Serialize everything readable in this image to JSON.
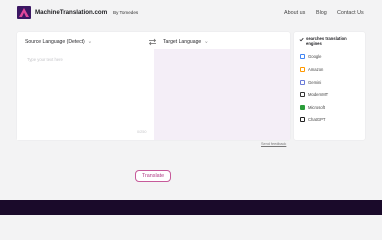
{
  "header": {
    "brand_name": "MachineTranslation.com",
    "brand_sub": "By Tomedes",
    "nav": [
      "About us",
      "Blog",
      "Contact Us"
    ]
  },
  "translator": {
    "source_language": "Source Language (Detect)",
    "target_language": "Target Language",
    "source_placeholder": "Type your text here",
    "char_count": "0/250",
    "feedback_link": "Send feedback",
    "translate_label": "Translate"
  },
  "sources": {
    "title": "searches translation engines",
    "items": [
      {
        "label": "Google",
        "icon": "google-icon",
        "color": "#4285f4"
      },
      {
        "label": "Amazon",
        "icon": "amazon-icon",
        "color": "#ff9900"
      },
      {
        "label": "Gemini",
        "icon": "gemini-icon",
        "color": "#6a7bd8"
      },
      {
        "label": "ModernMT",
        "icon": "modernmt-icon",
        "color": "#333333"
      },
      {
        "label": "Microsoft",
        "icon": "microsoft-icon",
        "color": "#2a9d3a"
      },
      {
        "label": "ChatGPT",
        "icon": "chatgpt-icon",
        "color": "#222222"
      }
    ]
  },
  "colors": {
    "accent": "#b03e86",
    "target_bg": "#f4eef7",
    "footer": "#1a0a2a"
  }
}
